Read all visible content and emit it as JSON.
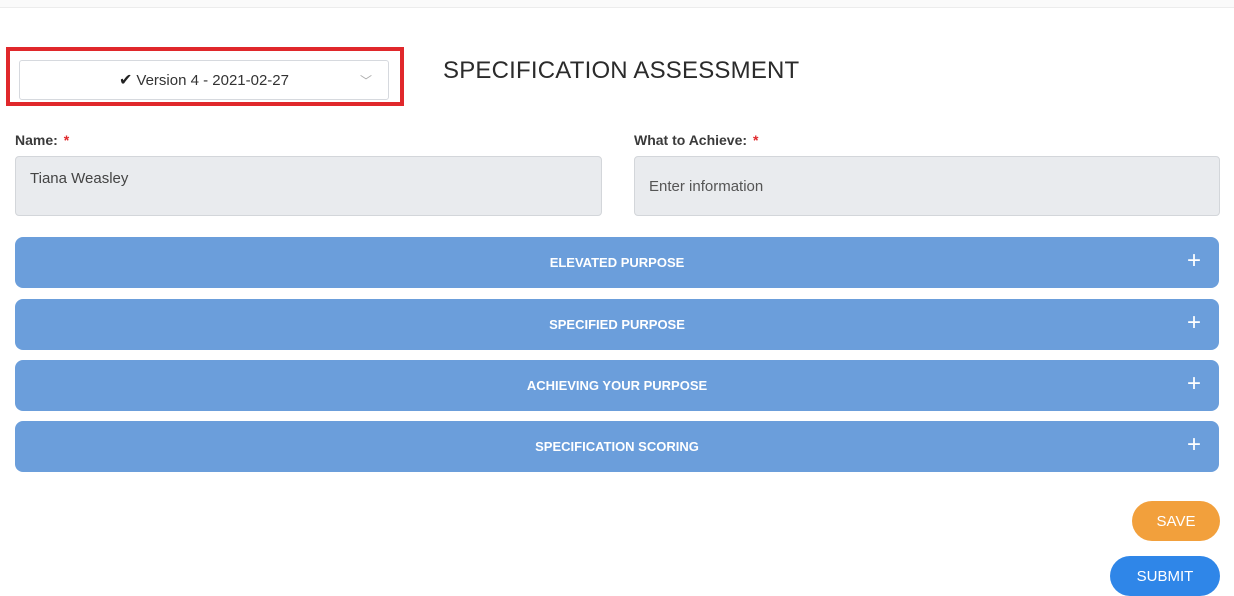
{
  "version_select": {
    "check_icon": "check-icon",
    "label": "Version 4 - 2021-02-27",
    "chevron_icon": "chevron-down-icon",
    "highlight_color": "#e0282b"
  },
  "page": {
    "title": "SPECIFICATION ASSESSMENT"
  },
  "form": {
    "name": {
      "label": "Name:",
      "required_mark": "*",
      "value": "Tiana Weasley"
    },
    "achieve": {
      "label": "What to Achieve:",
      "required_mark": "*",
      "placeholder": "Enter information",
      "value": ""
    }
  },
  "sections": [
    {
      "label": "ELEVATED PURPOSE",
      "toggle": "+"
    },
    {
      "label": "SPECIFIED PURPOSE",
      "toggle": "+"
    },
    {
      "label": "ACHIEVING YOUR PURPOSE",
      "toggle": "+"
    },
    {
      "label": "SPECIFICATION SCORING",
      "toggle": "+"
    }
  ],
  "actions": {
    "save_label": "SAVE",
    "submit_label": "SUBMIT",
    "save_color": "#f2a03c",
    "submit_color": "#2f86e8"
  },
  "colors": {
    "accordion": "#6b9edb",
    "required": "#e0282b"
  }
}
